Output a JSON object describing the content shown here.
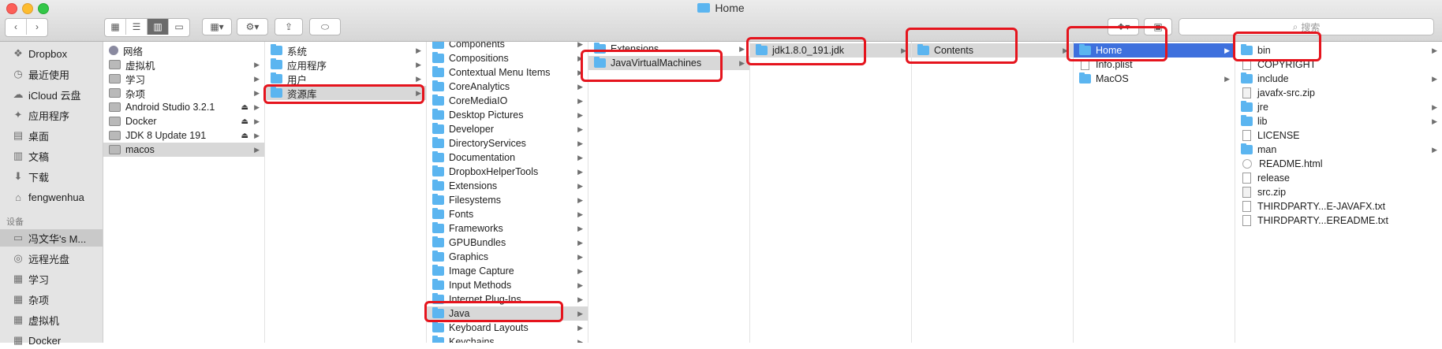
{
  "window": {
    "title": "Home"
  },
  "toolbar": {
    "search_placeholder": "搜索"
  },
  "sidebar": {
    "favorites": [
      {
        "label": "Dropbox",
        "icon": "dropbox-icon",
        "glyph": "❖"
      },
      {
        "label": "最近使用",
        "icon": "recents-icon",
        "glyph": "◷"
      },
      {
        "label": "iCloud 云盘",
        "icon": "cloud-icon",
        "glyph": "☁"
      },
      {
        "label": "应用程序",
        "icon": "applications-icon",
        "glyph": "✦"
      },
      {
        "label": "桌面",
        "icon": "desktop-icon",
        "glyph": "▤"
      },
      {
        "label": "文稿",
        "icon": "documents-icon",
        "glyph": "▥"
      },
      {
        "label": "下载",
        "icon": "downloads-icon",
        "glyph": "⬇"
      },
      {
        "label": "fengwenhua",
        "icon": "home-icon",
        "glyph": "⌂"
      }
    ],
    "devices_header": "设备",
    "devices": [
      {
        "label": "冯文华's M...",
        "icon": "laptop-icon",
        "glyph": "▭",
        "selected": true
      },
      {
        "label": "远程光盘",
        "icon": "disc-icon",
        "glyph": "◎"
      },
      {
        "label": "学习",
        "icon": "drive-icon",
        "glyph": "▦"
      },
      {
        "label": "杂项",
        "icon": "drive-icon",
        "glyph": "▦"
      },
      {
        "label": "虚拟机",
        "icon": "drive-icon",
        "glyph": "▦"
      },
      {
        "label": "Docker",
        "icon": "drive-icon",
        "glyph": "▦"
      }
    ]
  },
  "col1": [
    {
      "label": "网络",
      "icon": "globe"
    },
    {
      "label": "虚拟机",
      "icon": "drive",
      "arrow": true
    },
    {
      "label": "学习",
      "icon": "drive",
      "arrow": true
    },
    {
      "label": "杂项",
      "icon": "drive",
      "arrow": true
    },
    {
      "label": "Android Studio 3.2.1",
      "icon": "drive",
      "eject": true,
      "arrow": true
    },
    {
      "label": "Docker",
      "icon": "drive",
      "eject": true,
      "arrow": true
    },
    {
      "label": "JDK 8 Update 191",
      "icon": "drive",
      "eject": true,
      "arrow": true
    },
    {
      "label": "macos",
      "icon": "drive",
      "arrow": true,
      "hl": true
    }
  ],
  "col2": [
    {
      "label": "系统",
      "icon": "folder",
      "arrow": true
    },
    {
      "label": "应用程序",
      "icon": "folder",
      "arrow": true
    },
    {
      "label": "用户",
      "icon": "folder",
      "arrow": true
    },
    {
      "label": "资源库",
      "icon": "folder",
      "arrow": true,
      "hl": true
    }
  ],
  "col3": [
    {
      "label": "Components",
      "icon": "folder",
      "arrow": true
    },
    {
      "label": "Compositions",
      "icon": "folder",
      "arrow": true
    },
    {
      "label": "Contextual Menu Items",
      "icon": "folder",
      "arrow": true
    },
    {
      "label": "CoreAnalytics",
      "icon": "folder",
      "arrow": true
    },
    {
      "label": "CoreMediaIO",
      "icon": "folder",
      "arrow": true
    },
    {
      "label": "Desktop Pictures",
      "icon": "folder",
      "arrow": true
    },
    {
      "label": "Developer",
      "icon": "folder",
      "arrow": true
    },
    {
      "label": "DirectoryServices",
      "icon": "folder",
      "arrow": true
    },
    {
      "label": "Documentation",
      "icon": "folder",
      "arrow": true
    },
    {
      "label": "DropboxHelperTools",
      "icon": "folder",
      "arrow": true
    },
    {
      "label": "Extensions",
      "icon": "folder",
      "arrow": true
    },
    {
      "label": "Filesystems",
      "icon": "folder",
      "arrow": true
    },
    {
      "label": "Fonts",
      "icon": "folder",
      "arrow": true
    },
    {
      "label": "Frameworks",
      "icon": "folder",
      "arrow": true
    },
    {
      "label": "GPUBundles",
      "icon": "folder",
      "arrow": true
    },
    {
      "label": "Graphics",
      "icon": "folder",
      "arrow": true
    },
    {
      "label": "Image Capture",
      "icon": "folder",
      "arrow": true
    },
    {
      "label": "Input Methods",
      "icon": "folder",
      "arrow": true
    },
    {
      "label": "Internet Plug-Ins",
      "icon": "folder",
      "arrow": true
    },
    {
      "label": "Java",
      "icon": "folder",
      "arrow": true,
      "hl": true
    },
    {
      "label": "Keyboard Layouts",
      "icon": "folder",
      "arrow": true
    },
    {
      "label": "Keychains",
      "icon": "folder",
      "arrow": true
    }
  ],
  "col4": [
    {
      "label": "Extensions",
      "icon": "folder",
      "arrow": true
    },
    {
      "label": "JavaVirtualMachines",
      "icon": "folder",
      "arrow": true,
      "hl": true
    }
  ],
  "col5": [
    {
      "label": "jdk1.8.0_191.jdk",
      "icon": "folder",
      "arrow": true,
      "hl": true
    }
  ],
  "col6": [
    {
      "label": "Contents",
      "icon": "folder",
      "arrow": true,
      "hl": true
    }
  ],
  "col7": [
    {
      "label": "Home",
      "icon": "folder",
      "arrow": true,
      "blue": true
    },
    {
      "label": "Info.plist",
      "icon": "file"
    },
    {
      "label": "MacOS",
      "icon": "folder",
      "arrow": true
    }
  ],
  "col8": [
    {
      "label": "bin",
      "icon": "folder",
      "arrow": true
    },
    {
      "label": "COPYRIGHT",
      "icon": "file"
    },
    {
      "label": "include",
      "icon": "folder",
      "arrow": true
    },
    {
      "label": "javafx-src.zip",
      "icon": "zip"
    },
    {
      "label": "jre",
      "icon": "folder",
      "arrow": true
    },
    {
      "label": "lib",
      "icon": "folder",
      "arrow": true
    },
    {
      "label": "LICENSE",
      "icon": "file"
    },
    {
      "label": "man",
      "icon": "folder",
      "arrow": true
    },
    {
      "label": "README.html",
      "icon": "html"
    },
    {
      "label": "release",
      "icon": "file"
    },
    {
      "label": "src.zip",
      "icon": "zip"
    },
    {
      "label": "THIRDPARTY...E-JAVAFX.txt",
      "icon": "file"
    },
    {
      "label": "THIRDPARTY...EREADME.txt",
      "icon": "file"
    }
  ],
  "colors": {
    "selection_blue": "#3e70dd",
    "annotation_red": "#e5141d",
    "folder_blue": "#5bb5f0"
  }
}
